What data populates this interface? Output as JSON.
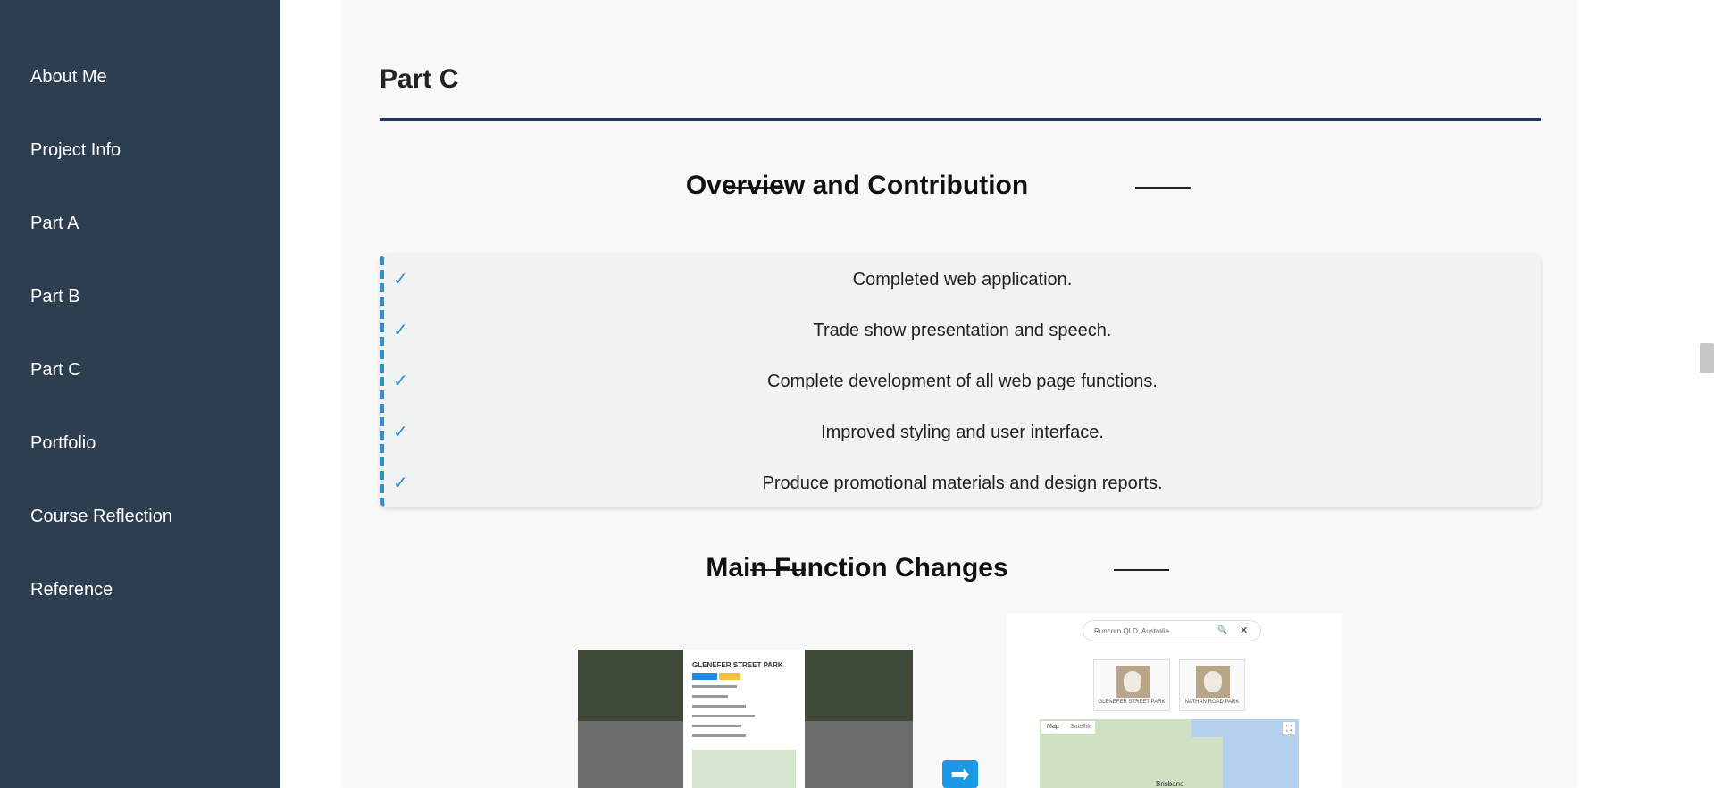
{
  "sidebar": {
    "items": [
      {
        "label": "About Me"
      },
      {
        "label": "Project Info"
      },
      {
        "label": "Part A"
      },
      {
        "label": "Part B"
      },
      {
        "label": "Part C"
      },
      {
        "label": "Portfolio"
      },
      {
        "label": "Course Reflection"
      },
      {
        "label": "Reference"
      }
    ]
  },
  "main": {
    "title": "Part C",
    "overview": {
      "heading": "Overview and Contribution",
      "check_mark": "✓",
      "items": [
        "Completed web application.",
        "Trade show presentation and speech.",
        "Complete development of all web page functions.",
        "Improved styling and user interface.",
        "Produce promotional materials and design reports."
      ]
    },
    "changes": {
      "heading": "Main Function Changes",
      "before_image": {
        "popup_title": "GLENEFER STREET PARK"
      },
      "arrow_icon": "➡",
      "after_image": {
        "search_value": "Runcorn QLD, Australia",
        "search_icon": "🔍",
        "clear_icon": "✕",
        "results": [
          "GLENEFER STREET PARK",
          "NATHAN ROAD PARK"
        ],
        "map_tabs": [
          "Map",
          "Satellite"
        ],
        "map_label": "Brisbane",
        "fullscreen_icon": "⛶"
      }
    }
  },
  "colors": {
    "sidebar_bg": "#2d3e50",
    "accent_blue": "#2f8fd0",
    "title_rule": "#1f3566"
  }
}
